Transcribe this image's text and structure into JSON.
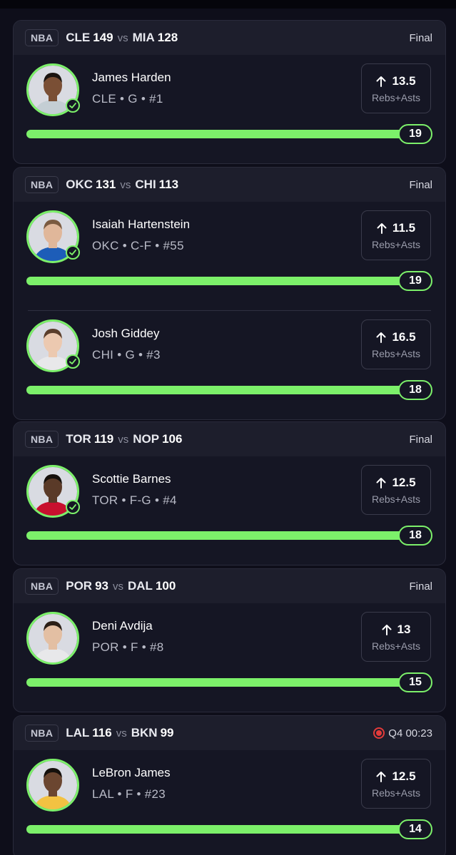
{
  "cards": [
    {
      "league": "NBA",
      "team1": "CLE",
      "score1": "149",
      "vs": "vs",
      "team2": "MIA",
      "score2": "128",
      "status": "Final",
      "players": [
        {
          "name": "James Harden",
          "info": "CLE • G • #1",
          "line": "13.5",
          "stat": "Rebs+Asts",
          "result": "19",
          "progress": 1.0,
          "hit": true,
          "jersey": "#c4ced4",
          "skin": "#7a4f35",
          "hair": "#1a1410"
        }
      ]
    },
    {
      "league": "NBA",
      "team1": "OKC",
      "score1": "131",
      "vs": "vs",
      "team2": "CHI",
      "score2": "113",
      "status": "Final",
      "players": [
        {
          "name": "Isaiah Hartenstein",
          "info": "OKC • C-F • #55",
          "line": "11.5",
          "stat": "Rebs+Asts",
          "result": "19",
          "progress": 1.0,
          "hit": true,
          "jersey": "#1d5db8",
          "skin": "#e0b79a",
          "hair": "#7a5a40"
        },
        {
          "name": "Josh Giddey",
          "info": "CHI • G • #3",
          "line": "16.5",
          "stat": "Rebs+Asts",
          "result": "18",
          "progress": 1.0,
          "hit": true,
          "jersey": "#e8e8ea",
          "skin": "#ecc9b0",
          "hair": "#5a3e2b"
        }
      ]
    },
    {
      "league": "NBA",
      "team1": "TOR",
      "score1": "119",
      "vs": "vs",
      "team2": "NOP",
      "score2": "106",
      "status": "Final",
      "players": [
        {
          "name": "Scottie Barnes",
          "info": "TOR • F-G • #4",
          "line": "12.5",
          "stat": "Rebs+Asts",
          "result": "18",
          "progress": 1.0,
          "hit": true,
          "jersey": "#c8102e",
          "skin": "#5a3a28",
          "hair": "#15100c"
        }
      ]
    },
    {
      "league": "NBA",
      "team1": "POR",
      "score1": "93",
      "vs": "vs",
      "team2": "DAL",
      "score2": "100",
      "status": "Final",
      "players": [
        {
          "name": "Deni Avdija",
          "info": "POR • F • #8",
          "line": "13",
          "stat": "Rebs+Asts",
          "result": "15",
          "progress": 1.0,
          "hit": false,
          "jersey": "#e8e8ea",
          "skin": "#e3bfa3",
          "hair": "#2a1e16"
        }
      ]
    },
    {
      "league": "NBA",
      "team1": "LAL",
      "score1": "116",
      "vs": "vs",
      "team2": "BKN",
      "score2": "99",
      "status": "Q4 00:23",
      "live": true,
      "players": [
        {
          "name": "LeBron James",
          "info": "LAL • F • #23",
          "line": "12.5",
          "stat": "Rebs+Asts",
          "result": "14",
          "progress": 1.0,
          "hit": false,
          "jersey": "#f3c242",
          "skin": "#6b4630",
          "hair": "#15100c"
        }
      ]
    }
  ],
  "colors": {
    "accent": "#7cf06a",
    "live": "#e23b3b",
    "background": "#0e0e1a",
    "card": "#151624"
  }
}
